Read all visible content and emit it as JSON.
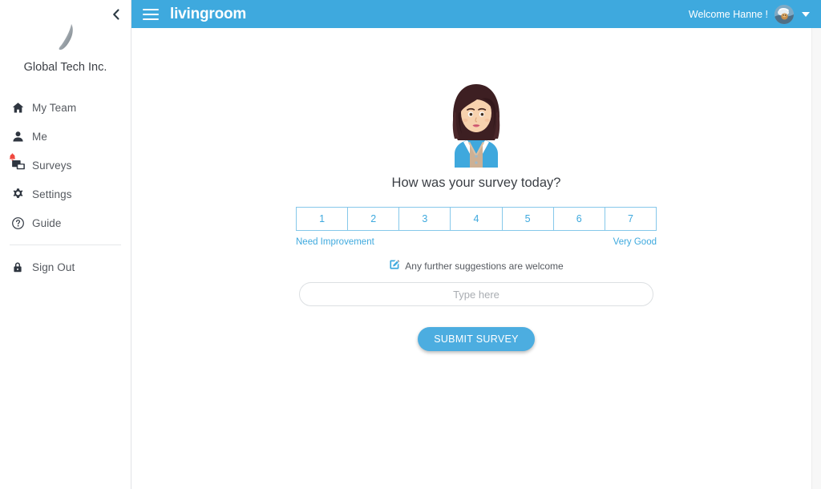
{
  "sidebar": {
    "collapse_icon": "chevron-left-icon",
    "logo_icon": "feather-logo",
    "org_name": "Global Tech Inc.",
    "items": [
      {
        "label": "My Team",
        "icon": "home-icon",
        "badge": false
      },
      {
        "label": "Me",
        "icon": "person-icon",
        "badge": false
      },
      {
        "label": "Surveys",
        "icon": "chat-bubbles-icon",
        "badge": true,
        "badge_icon": "bell-alert-icon"
      },
      {
        "label": "Settings",
        "icon": "gear-icon",
        "badge": false
      },
      {
        "label": "Guide",
        "icon": "question-circle-icon",
        "badge": false
      }
    ],
    "footer_items": [
      {
        "label": "Sign Out",
        "icon": "lock-icon"
      }
    ]
  },
  "header": {
    "menu_icon": "hamburger-icon",
    "app_title": "livingroom",
    "welcome_text": "Welcome Hanne !",
    "avatar_icon": "user-avatar-photo",
    "caret_icon": "chevron-down-icon"
  },
  "survey": {
    "illustration_icon": "woman-avatar-illustration",
    "question": "How was your survey today?",
    "scale_options": [
      "1",
      "2",
      "3",
      "4",
      "5",
      "6",
      "7"
    ],
    "legend_low": "Need Improvement",
    "legend_high": "Very Good",
    "suggestion_icon": "edit-square-icon",
    "suggestion_label": "Any further suggestions are welcome",
    "input_value": "",
    "input_placeholder": "Type here",
    "submit_label": "SUBMIT SURVEY"
  },
  "colors": {
    "brand_blue": "#3ea9de",
    "button_blue": "#4cade0",
    "scale_border": "#86c8ea",
    "badge_red": "#f0483e"
  }
}
